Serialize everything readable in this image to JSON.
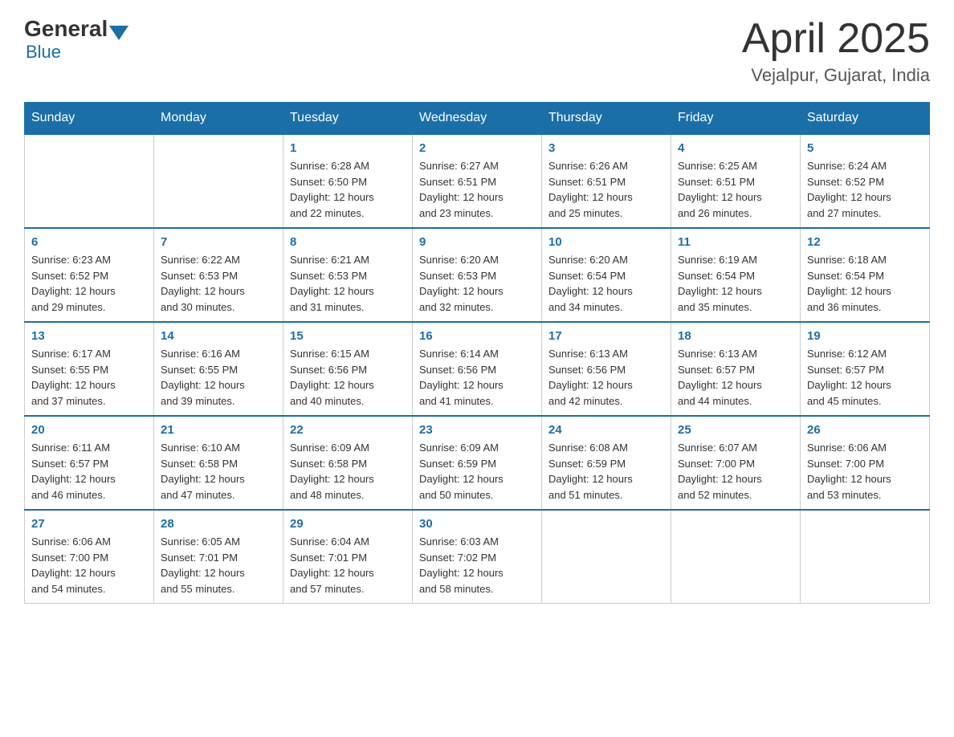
{
  "header": {
    "logo_general": "General",
    "logo_blue": "Blue",
    "title": "April 2025",
    "location": "Vejalpur, Gujarat, India"
  },
  "weekdays": [
    "Sunday",
    "Monday",
    "Tuesday",
    "Wednesday",
    "Thursday",
    "Friday",
    "Saturday"
  ],
  "weeks": [
    [
      {
        "day": "",
        "info": ""
      },
      {
        "day": "",
        "info": ""
      },
      {
        "day": "1",
        "info": "Sunrise: 6:28 AM\nSunset: 6:50 PM\nDaylight: 12 hours\nand 22 minutes."
      },
      {
        "day": "2",
        "info": "Sunrise: 6:27 AM\nSunset: 6:51 PM\nDaylight: 12 hours\nand 23 minutes."
      },
      {
        "day": "3",
        "info": "Sunrise: 6:26 AM\nSunset: 6:51 PM\nDaylight: 12 hours\nand 25 minutes."
      },
      {
        "day": "4",
        "info": "Sunrise: 6:25 AM\nSunset: 6:51 PM\nDaylight: 12 hours\nand 26 minutes."
      },
      {
        "day": "5",
        "info": "Sunrise: 6:24 AM\nSunset: 6:52 PM\nDaylight: 12 hours\nand 27 minutes."
      }
    ],
    [
      {
        "day": "6",
        "info": "Sunrise: 6:23 AM\nSunset: 6:52 PM\nDaylight: 12 hours\nand 29 minutes."
      },
      {
        "day": "7",
        "info": "Sunrise: 6:22 AM\nSunset: 6:53 PM\nDaylight: 12 hours\nand 30 minutes."
      },
      {
        "day": "8",
        "info": "Sunrise: 6:21 AM\nSunset: 6:53 PM\nDaylight: 12 hours\nand 31 minutes."
      },
      {
        "day": "9",
        "info": "Sunrise: 6:20 AM\nSunset: 6:53 PM\nDaylight: 12 hours\nand 32 minutes."
      },
      {
        "day": "10",
        "info": "Sunrise: 6:20 AM\nSunset: 6:54 PM\nDaylight: 12 hours\nand 34 minutes."
      },
      {
        "day": "11",
        "info": "Sunrise: 6:19 AM\nSunset: 6:54 PM\nDaylight: 12 hours\nand 35 minutes."
      },
      {
        "day": "12",
        "info": "Sunrise: 6:18 AM\nSunset: 6:54 PM\nDaylight: 12 hours\nand 36 minutes."
      }
    ],
    [
      {
        "day": "13",
        "info": "Sunrise: 6:17 AM\nSunset: 6:55 PM\nDaylight: 12 hours\nand 37 minutes."
      },
      {
        "day": "14",
        "info": "Sunrise: 6:16 AM\nSunset: 6:55 PM\nDaylight: 12 hours\nand 39 minutes."
      },
      {
        "day": "15",
        "info": "Sunrise: 6:15 AM\nSunset: 6:56 PM\nDaylight: 12 hours\nand 40 minutes."
      },
      {
        "day": "16",
        "info": "Sunrise: 6:14 AM\nSunset: 6:56 PM\nDaylight: 12 hours\nand 41 minutes."
      },
      {
        "day": "17",
        "info": "Sunrise: 6:13 AM\nSunset: 6:56 PM\nDaylight: 12 hours\nand 42 minutes."
      },
      {
        "day": "18",
        "info": "Sunrise: 6:13 AM\nSunset: 6:57 PM\nDaylight: 12 hours\nand 44 minutes."
      },
      {
        "day": "19",
        "info": "Sunrise: 6:12 AM\nSunset: 6:57 PM\nDaylight: 12 hours\nand 45 minutes."
      }
    ],
    [
      {
        "day": "20",
        "info": "Sunrise: 6:11 AM\nSunset: 6:57 PM\nDaylight: 12 hours\nand 46 minutes."
      },
      {
        "day": "21",
        "info": "Sunrise: 6:10 AM\nSunset: 6:58 PM\nDaylight: 12 hours\nand 47 minutes."
      },
      {
        "day": "22",
        "info": "Sunrise: 6:09 AM\nSunset: 6:58 PM\nDaylight: 12 hours\nand 48 minutes."
      },
      {
        "day": "23",
        "info": "Sunrise: 6:09 AM\nSunset: 6:59 PM\nDaylight: 12 hours\nand 50 minutes."
      },
      {
        "day": "24",
        "info": "Sunrise: 6:08 AM\nSunset: 6:59 PM\nDaylight: 12 hours\nand 51 minutes."
      },
      {
        "day": "25",
        "info": "Sunrise: 6:07 AM\nSunset: 7:00 PM\nDaylight: 12 hours\nand 52 minutes."
      },
      {
        "day": "26",
        "info": "Sunrise: 6:06 AM\nSunset: 7:00 PM\nDaylight: 12 hours\nand 53 minutes."
      }
    ],
    [
      {
        "day": "27",
        "info": "Sunrise: 6:06 AM\nSunset: 7:00 PM\nDaylight: 12 hours\nand 54 minutes."
      },
      {
        "day": "28",
        "info": "Sunrise: 6:05 AM\nSunset: 7:01 PM\nDaylight: 12 hours\nand 55 minutes."
      },
      {
        "day": "29",
        "info": "Sunrise: 6:04 AM\nSunset: 7:01 PM\nDaylight: 12 hours\nand 57 minutes."
      },
      {
        "day": "30",
        "info": "Sunrise: 6:03 AM\nSunset: 7:02 PM\nDaylight: 12 hours\nand 58 minutes."
      },
      {
        "day": "",
        "info": ""
      },
      {
        "day": "",
        "info": ""
      },
      {
        "day": "",
        "info": ""
      }
    ]
  ]
}
